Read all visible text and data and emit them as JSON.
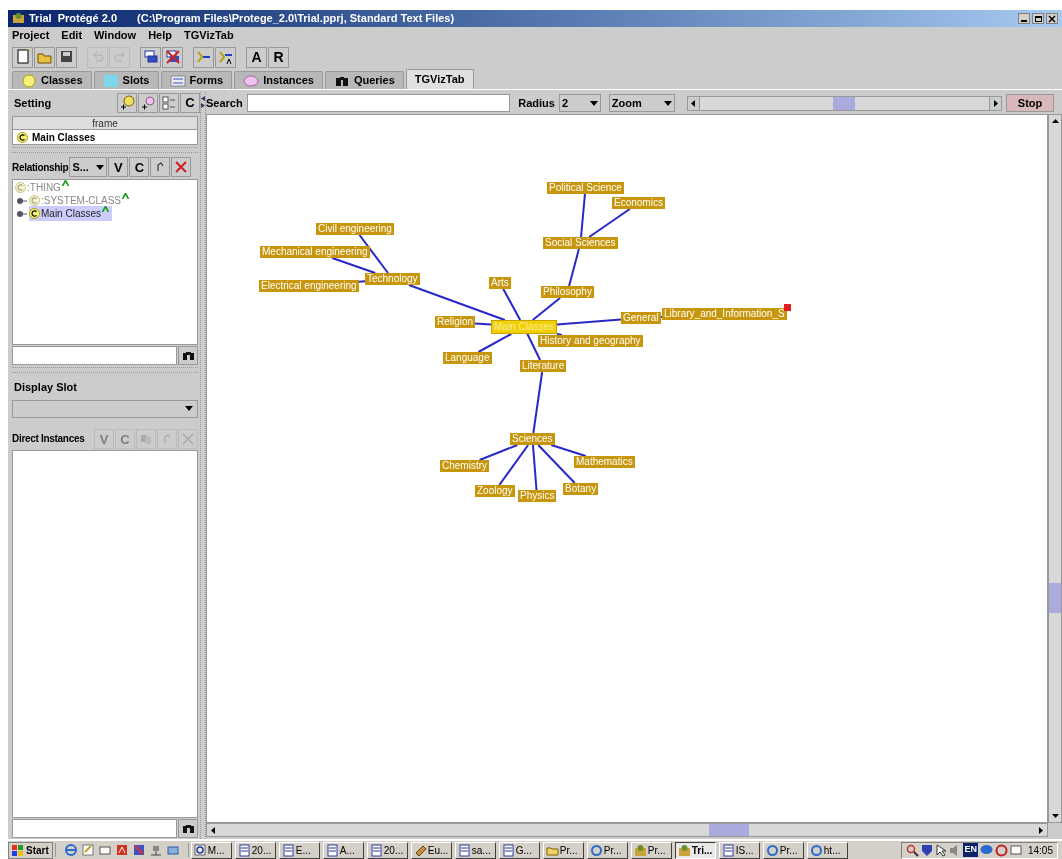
{
  "window": {
    "title": "Trial  Protégé 2.0",
    "subtitle": "(C:\\Program Files\\Protege_2.0\\Trial.pprj, Standard Text Files)"
  },
  "menu": [
    "Project",
    "Edit",
    "Window",
    "Help",
    "TGVizTab"
  ],
  "toolbar": [
    {
      "kind": "new",
      "disabled": false
    },
    {
      "kind": "open",
      "disabled": false
    },
    {
      "kind": "save",
      "disabled": false
    },
    {
      "kind": "undo",
      "disabled": true
    },
    {
      "kind": "redo",
      "disabled": true
    },
    {
      "kind": "create-class",
      "disabled": false
    },
    {
      "kind": "delete-class",
      "disabled": false
    },
    {
      "kind": "insert",
      "disabled": false
    },
    {
      "kind": "insert-a",
      "disabled": false
    },
    {
      "kind": "text",
      "label": "A",
      "disabled": false
    },
    {
      "kind": "text",
      "label": "R",
      "disabled": false
    }
  ],
  "tabs": [
    {
      "label": "Classes",
      "kind": "classes",
      "selected": false
    },
    {
      "label": "Slots",
      "kind": "slots",
      "selected": false
    },
    {
      "label": "Forms",
      "kind": "forms",
      "selected": false
    },
    {
      "label": "Instances",
      "kind": "instances",
      "selected": false
    },
    {
      "label": "Queries",
      "kind": "queries",
      "selected": false
    },
    {
      "label": "TGVizTab",
      "kind": "plain",
      "selected": true
    }
  ],
  "left_panel": {
    "setting": {
      "label": "Setting",
      "button": "C"
    },
    "frame_table": {
      "column": "frame",
      "row": "Main Classes"
    },
    "relationship": {
      "label": "Relationship",
      "combo": "S...",
      "buttons": [
        "V",
        "C"
      ]
    },
    "class_tree": [
      {
        "label": ":THING",
        "kind": "system",
        "selected": false,
        "children": [
          {
            "label": ":SYSTEM-CLASS",
            "kind": "system",
            "selected": false,
            "expanded": false
          },
          {
            "label": "Main Classes",
            "kind": "user",
            "selected": true,
            "expanded": false
          }
        ]
      }
    ],
    "display_slot": {
      "label": "Display Slot"
    },
    "direct_instances": {
      "label": "Direct Instances",
      "buttons": [
        {
          "label": "V",
          "disabled": true
        },
        {
          "label": "C",
          "disabled": true
        }
      ]
    }
  },
  "viz": {
    "zoom_slider": {
      "level": 0.5
    },
    "search_label": "Search",
    "radius_label": "Radius",
    "radius_value": "2",
    "zoom_value": "Zoom",
    "stop_button": "Stop",
    "graph": {
      "label": "Main Classes",
      "selected": true,
      "children": [
        {
          "label": "Technology",
          "selected": false,
          "children": [
            {
              "label": "Civil engineering",
              "selected": false
            },
            {
              "label": "Mechanical engineering",
              "selected": false
            },
            {
              "label": "Electrical engineering",
              "selected": false
            }
          ]
        },
        {
          "label": "Arts",
          "selected": false
        },
        {
          "label": "Philosophy",
          "selected": false,
          "children": [
            {
              "label": "Social Sciences",
              "selected": false,
              "children": [
                {
                  "label": "Political Science",
                  "selected": false
                },
                {
                  "label": "Economics",
                  "selected": false
                }
              ]
            }
          ]
        },
        {
          "label": "Religion",
          "selected": false
        },
        {
          "label": "General",
          "selected": false,
          "children": [
            {
              "label": "Library_and_Information_S",
              "selected": false,
              "collapsed": true
            }
          ]
        },
        {
          "label": "History and geography",
          "selected": false
        },
        {
          "label": "Language",
          "selected": false
        },
        {
          "label": "Literature",
          "selected": false,
          "children": [
            {
              "label": "Sciences",
              "selected": false,
              "children": [
                {
                  "label": "Chemistry",
                  "selected": false
                },
                {
                  "label": "Mathematics",
                  "selected": false
                },
                {
                  "label": "Zoology",
                  "selected": false
                },
                {
                  "label": "Physics",
                  "selected": false
                },
                {
                  "label": "Botany",
                  "selected": false
                }
              ]
            }
          ]
        }
      ]
    }
  },
  "taskbar": {
    "start": "Start",
    "tasks": [
      {
        "label": "M...",
        "kind": "viewer",
        "selected": false
      },
      {
        "label": "20...",
        "kind": "word",
        "selected": false
      },
      {
        "label": "E...",
        "kind": "word",
        "selected": false
      },
      {
        "label": "A...",
        "kind": "word",
        "selected": false
      },
      {
        "label": "20...",
        "kind": "word",
        "selected": false
      },
      {
        "label": "Eu...",
        "kind": "tool",
        "selected": false
      },
      {
        "label": "sa...",
        "kind": "word",
        "selected": false
      },
      {
        "label": "G...",
        "kind": "word",
        "selected": false
      },
      {
        "label": "Pr...",
        "kind": "folder",
        "selected": false
      },
      {
        "label": "Pr...",
        "kind": "browser",
        "selected": false
      },
      {
        "label": "Pr...",
        "kind": "protege",
        "selected": false
      },
      {
        "label": "Tri...",
        "kind": "protege",
        "selected": true
      },
      {
        "label": "IS...",
        "kind": "word",
        "selected": false
      },
      {
        "label": "Pr...",
        "kind": "browser",
        "selected": false
      },
      {
        "label": "ht...",
        "kind": "browser",
        "selected": false
      }
    ],
    "tray_language": "EN",
    "clock": "14:05"
  }
}
